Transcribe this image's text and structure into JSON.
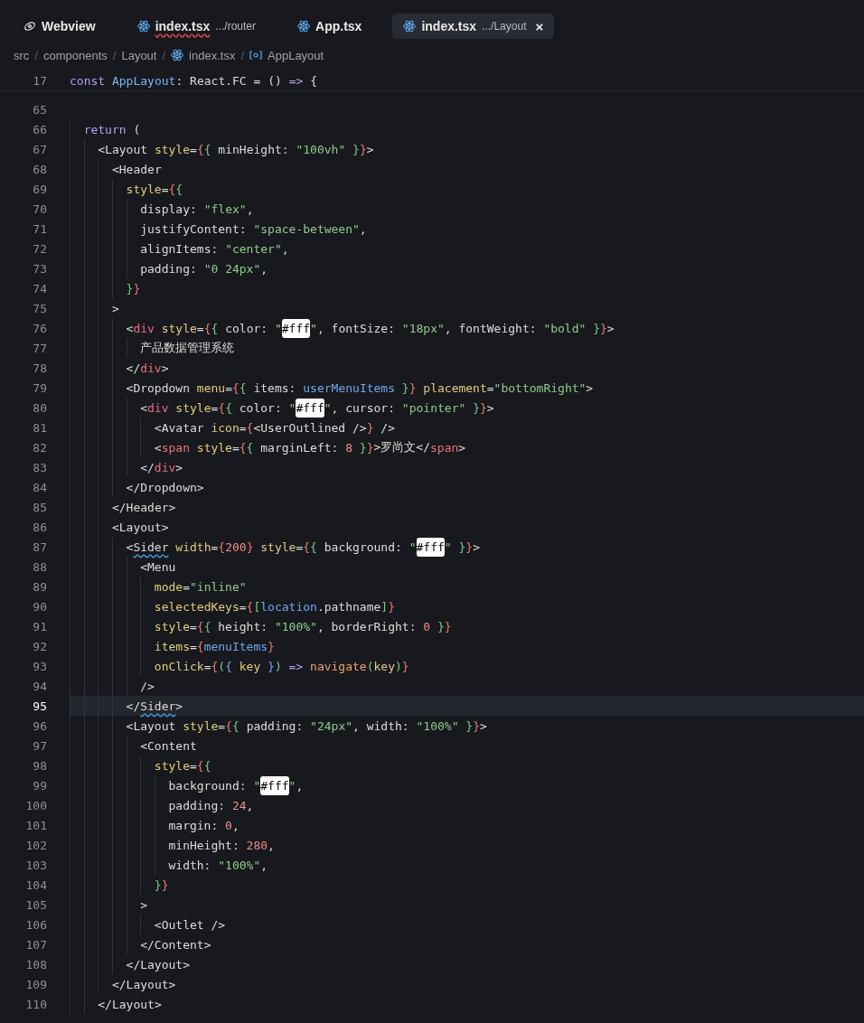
{
  "tabs": [
    {
      "kind": "eye",
      "label": "Webview",
      "selected": false,
      "error": false
    },
    {
      "kind": "react",
      "label": "index.tsx",
      "description": ".../router",
      "error": true,
      "selected": false
    },
    {
      "kind": "react",
      "label": "App.tsx",
      "selected": false,
      "error": false
    },
    {
      "kind": "react",
      "label": "index.tsx",
      "description": ".../Layout",
      "selected": true,
      "error": false,
      "close": "×"
    }
  ],
  "breadcrumb": {
    "separator": "/",
    "items": [
      {
        "label": "src"
      },
      {
        "label": "components"
      },
      {
        "label": "Layout"
      },
      {
        "label": "index.tsx",
        "kind": "react"
      },
      {
        "label": "AppLayout",
        "kind": "symbol"
      }
    ]
  },
  "sticky_line": {
    "number": "17",
    "tokens": [
      {
        "kind": "kw",
        "text": "const "
      },
      {
        "kind": "type",
        "text": "AppLayout"
      },
      {
        "kind": "text",
        "text": ": React.FC = () "
      },
      {
        "kind": "kw",
        "text": "=>"
      },
      {
        "kind": "text",
        "text": " {"
      }
    ]
  },
  "lines": [
    {
      "number": "65",
      "current": false
    },
    {
      "number": "66",
      "current": false,
      "tokens": [
        {
          "kind": "kw",
          "text": "  return"
        },
        {
          "kind": "text",
          "text": " ("
        }
      ]
    },
    {
      "number": "67",
      "current": false,
      "tokens": [
        {
          "kind": "text",
          "text": "    <Layout "
        },
        {
          "kind": "attr",
          "text": "style"
        },
        {
          "kind": "text",
          "text": "="
        },
        {
          "kind": "b1",
          "text": "{"
        },
        {
          "kind": "b2",
          "text": "{"
        },
        {
          "kind": "text",
          "text": " minHeight: "
        },
        {
          "kind": "str",
          "text": "\"100vh\" "
        },
        {
          "kind": "b2",
          "text": "}"
        },
        {
          "kind": "b1",
          "text": "}"
        },
        {
          "kind": "text",
          "text": ">"
        }
      ]
    },
    {
      "number": "68",
      "current": false,
      "tokens": [
        {
          "kind": "text",
          "text": "      <Header"
        }
      ]
    },
    {
      "number": "69",
      "current": false,
      "tokens": [
        {
          "kind": "attr",
          "text": "        style"
        },
        {
          "kind": "text",
          "text": "="
        },
        {
          "kind": "b1",
          "text": "{"
        },
        {
          "kind": "b2",
          "text": "{"
        }
      ]
    },
    {
      "number": "70",
      "current": false,
      "tokens": [
        {
          "kind": "text",
          "text": "          display: "
        },
        {
          "kind": "str",
          "text": "\"flex\""
        },
        {
          "kind": "text",
          "text": ","
        }
      ]
    },
    {
      "number": "71",
      "current": false,
      "tokens": [
        {
          "kind": "text",
          "text": "          justifyContent: "
        },
        {
          "kind": "str",
          "text": "\"space-between\""
        },
        {
          "kind": "text",
          "text": ","
        }
      ]
    },
    {
      "number": "72",
      "current": false,
      "tokens": [
        {
          "kind": "text",
          "text": "          alignItems: "
        },
        {
          "kind": "str",
          "text": "\"center\""
        },
        {
          "kind": "text",
          "text": ","
        }
      ]
    },
    {
      "number": "73",
      "current": false,
      "tokens": [
        {
          "kind": "text",
          "text": "          padding: "
        },
        {
          "kind": "str",
          "text": "\"0 24px\""
        },
        {
          "kind": "text",
          "text": ","
        }
      ]
    },
    {
      "number": "74",
      "current": false,
      "tokens": [
        {
          "kind": "b2",
          "text": "        }"
        },
        {
          "kind": "b1",
          "text": "}"
        }
      ]
    },
    {
      "number": "75",
      "current": false,
      "tokens": [
        {
          "kind": "text",
          "text": "      >"
        }
      ]
    },
    {
      "number": "76",
      "current": false,
      "tokens": [
        {
          "kind": "text",
          "text": "        <"
        },
        {
          "kind": "el",
          "text": "div"
        },
        {
          "kind": "attr",
          "text": " style"
        },
        {
          "kind": "text",
          "text": "="
        },
        {
          "kind": "b1",
          "text": "{"
        },
        {
          "kind": "b2",
          "text": "{"
        },
        {
          "kind": "text",
          "text": " color: "
        },
        {
          "kind": "str",
          "text": "\""
        },
        {
          "kind": "color",
          "text": "#fff"
        },
        {
          "kind": "str",
          "text": "\""
        },
        {
          "kind": "text",
          "text": ", fontSize: "
        },
        {
          "kind": "str",
          "text": "\"18px\""
        },
        {
          "kind": "text",
          "text": ", fontWeight: "
        },
        {
          "kind": "str",
          "text": "\"bold\" "
        },
        {
          "kind": "b2",
          "text": "}"
        },
        {
          "kind": "b1",
          "text": "}"
        },
        {
          "kind": "text",
          "text": ">"
        }
      ]
    },
    {
      "number": "77",
      "current": false,
      "tokens": [
        {
          "kind": "text",
          "text": "          产品数据管理系统"
        }
      ]
    },
    {
      "number": "78",
      "current": false,
      "tokens": [
        {
          "kind": "text",
          "text": "        </"
        },
        {
          "kind": "el",
          "text": "div"
        },
        {
          "kind": "text",
          "text": ">"
        }
      ]
    },
    {
      "number": "79",
      "current": false,
      "tokens": [
        {
          "kind": "text",
          "text": "        <Dropdown "
        },
        {
          "kind": "attr",
          "text": "menu"
        },
        {
          "kind": "text",
          "text": "="
        },
        {
          "kind": "b1",
          "text": "{"
        },
        {
          "kind": "b2",
          "text": "{"
        },
        {
          "kind": "text",
          "text": " items: "
        },
        {
          "kind": "var",
          "text": "userMenuItems "
        },
        {
          "kind": "b2",
          "text": "}"
        },
        {
          "kind": "b1",
          "text": "}"
        },
        {
          "kind": "attr",
          "text": " placement"
        },
        {
          "kind": "text",
          "text": "="
        },
        {
          "kind": "str",
          "text": "\"bottomRight\""
        },
        {
          "kind": "text",
          "text": ">"
        }
      ]
    },
    {
      "number": "80",
      "current": false,
      "tokens": [
        {
          "kind": "text",
          "text": "          <"
        },
        {
          "kind": "el",
          "text": "div"
        },
        {
          "kind": "attr",
          "text": " style"
        },
        {
          "kind": "text",
          "text": "="
        },
        {
          "kind": "b1",
          "text": "{"
        },
        {
          "kind": "b2",
          "text": "{"
        },
        {
          "kind": "text",
          "text": " color: "
        },
        {
          "kind": "str",
          "text": "\""
        },
        {
          "kind": "color",
          "text": "#fff"
        },
        {
          "kind": "str",
          "text": "\""
        },
        {
          "kind": "text",
          "text": ", cursor: "
        },
        {
          "kind": "str",
          "text": "\"pointer\" "
        },
        {
          "kind": "b2",
          "text": "}"
        },
        {
          "kind": "b1",
          "text": "}"
        },
        {
          "kind": "text",
          "text": ">"
        }
      ]
    },
    {
      "number": "81",
      "current": false,
      "tokens": [
        {
          "kind": "text",
          "text": "            <Avatar "
        },
        {
          "kind": "attr",
          "text": "icon"
        },
        {
          "kind": "text",
          "text": "="
        },
        {
          "kind": "b1",
          "text": "{"
        },
        {
          "kind": "text",
          "text": "<UserOutlined />"
        },
        {
          "kind": "b1",
          "text": "}"
        },
        {
          "kind": "text",
          "text": " />"
        }
      ]
    },
    {
      "number": "82",
      "current": false,
      "tokens": [
        {
          "kind": "text",
          "text": "            <"
        },
        {
          "kind": "el",
          "text": "span"
        },
        {
          "kind": "attr",
          "text": " style"
        },
        {
          "kind": "text",
          "text": "="
        },
        {
          "kind": "b1",
          "text": "{"
        },
        {
          "kind": "b2",
          "text": "{"
        },
        {
          "kind": "text",
          "text": " marginLeft: "
        },
        {
          "kind": "num",
          "text": "8 "
        },
        {
          "kind": "b2",
          "text": "}"
        },
        {
          "kind": "b1",
          "text": "}"
        },
        {
          "kind": "text",
          "text": ">罗尚文</"
        },
        {
          "kind": "el",
          "text": "span"
        },
        {
          "kind": "text",
          "text": ">"
        }
      ]
    },
    {
      "number": "83",
      "current": false,
      "tokens": [
        {
          "kind": "text",
          "text": "          </"
        },
        {
          "kind": "el",
          "text": "div"
        },
        {
          "kind": "text",
          "text": ">"
        }
      ]
    },
    {
      "number": "84",
      "current": false,
      "tokens": [
        {
          "kind": "text",
          "text": "        </Dropdown>"
        }
      ]
    },
    {
      "number": "85",
      "current": false,
      "tokens": [
        {
          "kind": "text",
          "text": "      </Header>"
        }
      ]
    },
    {
      "number": "86",
      "current": false,
      "tokens": [
        {
          "kind": "text",
          "text": "      <Layout>"
        }
      ]
    },
    {
      "number": "87",
      "current": false,
      "tokens": [
        {
          "kind": "text",
          "text": "        <"
        },
        {
          "kind": "text",
          "text": "Sider",
          "squiggle": true
        },
        {
          "kind": "attr",
          "text": " width"
        },
        {
          "kind": "text",
          "text": "="
        },
        {
          "kind": "b1",
          "text": "{"
        },
        {
          "kind": "num",
          "text": "200"
        },
        {
          "kind": "b1",
          "text": "}"
        },
        {
          "kind": "attr",
          "text": " style"
        },
        {
          "kind": "text",
          "text": "="
        },
        {
          "kind": "b1",
          "text": "{"
        },
        {
          "kind": "b2",
          "text": "{"
        },
        {
          "kind": "text",
          "text": " background: "
        },
        {
          "kind": "str",
          "text": "\""
        },
        {
          "kind": "color",
          "text": "#fff"
        },
        {
          "kind": "str",
          "text": "\" "
        },
        {
          "kind": "b2",
          "text": "}"
        },
        {
          "kind": "b1",
          "text": "}"
        },
        {
          "kind": "text",
          "text": ">"
        }
      ]
    },
    {
      "number": "88",
      "current": false,
      "tokens": [
        {
          "kind": "text",
          "text": "          <Menu"
        }
      ]
    },
    {
      "number": "89",
      "current": false,
      "tokens": [
        {
          "kind": "attr",
          "text": "            mode"
        },
        {
          "kind": "text",
          "text": "="
        },
        {
          "kind": "str",
          "text": "\"inline\""
        }
      ]
    },
    {
      "number": "90",
      "current": false,
      "tokens": [
        {
          "kind": "attr",
          "text": "            selectedKeys"
        },
        {
          "kind": "text",
          "text": "="
        },
        {
          "kind": "b1",
          "text": "{"
        },
        {
          "kind": "b2",
          "text": "["
        },
        {
          "kind": "var",
          "text": "location"
        },
        {
          "kind": "text",
          "text": ".pathname"
        },
        {
          "kind": "b2",
          "text": "]"
        },
        {
          "kind": "b1",
          "text": "}"
        }
      ]
    },
    {
      "number": "91",
      "current": false,
      "tokens": [
        {
          "kind": "attr",
          "text": "            style"
        },
        {
          "kind": "text",
          "text": "="
        },
        {
          "kind": "b1",
          "text": "{"
        },
        {
          "kind": "b2",
          "text": "{"
        },
        {
          "kind": "text",
          "text": " height: "
        },
        {
          "kind": "str",
          "text": "\"100%\""
        },
        {
          "kind": "text",
          "text": ", borderRight: "
        },
        {
          "kind": "num",
          "text": "0 "
        },
        {
          "kind": "b2",
          "text": "}"
        },
        {
          "kind": "b1",
          "text": "}"
        }
      ]
    },
    {
      "number": "92",
      "current": false,
      "tokens": [
        {
          "kind": "attr",
          "text": "            items"
        },
        {
          "kind": "text",
          "text": "="
        },
        {
          "kind": "b1",
          "text": "{"
        },
        {
          "kind": "var",
          "text": "menuItems"
        },
        {
          "kind": "b1",
          "text": "}"
        }
      ]
    },
    {
      "number": "93",
      "current": false,
      "tokens": [
        {
          "kind": "attr",
          "text": "            onClick"
        },
        {
          "kind": "text",
          "text": "="
        },
        {
          "kind": "b1",
          "text": "{"
        },
        {
          "kind": "b2",
          "text": "("
        },
        {
          "kind": "b3",
          "text": "{"
        },
        {
          "kind": "attr",
          "text": " key "
        },
        {
          "kind": "b3",
          "text": "}"
        },
        {
          "kind": "b2",
          "text": ")"
        },
        {
          "kind": "kw",
          "text": " => "
        },
        {
          "kind": "fn",
          "text": "navigate"
        },
        {
          "kind": "b2",
          "text": "("
        },
        {
          "kind": "attr",
          "text": "key"
        },
        {
          "kind": "b2",
          "text": ")"
        },
        {
          "kind": "b1",
          "text": "}"
        }
      ]
    },
    {
      "number": "94",
      "current": false,
      "tokens": [
        {
          "kind": "text",
          "text": "          />"
        }
      ]
    },
    {
      "number": "95",
      "current": true,
      "tokens": [
        {
          "kind": "text",
          "text": "        </"
        },
        {
          "kind": "text",
          "text": "Sider",
          "squiggle": true
        },
        {
          "kind": "text",
          "text": ">"
        }
      ]
    },
    {
      "number": "96",
      "current": false,
      "tokens": [
        {
          "kind": "text",
          "text": "        <Layout "
        },
        {
          "kind": "attr",
          "text": "style"
        },
        {
          "kind": "text",
          "text": "="
        },
        {
          "kind": "b1",
          "text": "{"
        },
        {
          "kind": "b2",
          "text": "{"
        },
        {
          "kind": "text",
          "text": " padding: "
        },
        {
          "kind": "str",
          "text": "\"24px\""
        },
        {
          "kind": "text",
          "text": ", width: "
        },
        {
          "kind": "str",
          "text": "\"100%\" "
        },
        {
          "kind": "b2",
          "text": "}"
        },
        {
          "kind": "b1",
          "text": "}"
        },
        {
          "kind": "text",
          "text": ">"
        }
      ]
    },
    {
      "number": "97",
      "current": false,
      "tokens": [
        {
          "kind": "text",
          "text": "          <Content"
        }
      ]
    },
    {
      "number": "98",
      "current": false,
      "tokens": [
        {
          "kind": "attr",
          "text": "            style"
        },
        {
          "kind": "text",
          "text": "="
        },
        {
          "kind": "b1",
          "text": "{"
        },
        {
          "kind": "b2",
          "text": "{"
        }
      ]
    },
    {
      "number": "99",
      "current": false,
      "tokens": [
        {
          "kind": "text",
          "text": "              background: "
        },
        {
          "kind": "str",
          "text": "\""
        },
        {
          "kind": "color",
          "text": "#fff"
        },
        {
          "kind": "str",
          "text": "\""
        },
        {
          "kind": "text",
          "text": ","
        }
      ]
    },
    {
      "number": "100",
      "current": false,
      "tokens": [
        {
          "kind": "text",
          "text": "              padding: "
        },
        {
          "kind": "num",
          "text": "24"
        },
        {
          "kind": "text",
          "text": ","
        }
      ]
    },
    {
      "number": "101",
      "current": false,
      "tokens": [
        {
          "kind": "text",
          "text": "              margin: "
        },
        {
          "kind": "num",
          "text": "0"
        },
        {
          "kind": "text",
          "text": ","
        }
      ]
    },
    {
      "number": "102",
      "current": false,
      "tokens": [
        {
          "kind": "text",
          "text": "              minHeight: "
        },
        {
          "kind": "num",
          "text": "280"
        },
        {
          "kind": "text",
          "text": ","
        }
      ]
    },
    {
      "number": "103",
      "current": false,
      "tokens": [
        {
          "kind": "text",
          "text": "              width: "
        },
        {
          "kind": "str",
          "text": "\"100%\""
        },
        {
          "kind": "text",
          "text": ","
        }
      ]
    },
    {
      "number": "104",
      "current": false,
      "tokens": [
        {
          "kind": "b2",
          "text": "            }"
        },
        {
          "kind": "b1",
          "text": "}"
        }
      ]
    },
    {
      "number": "105",
      "current": false,
      "tokens": [
        {
          "kind": "text",
          "text": "          >"
        }
      ]
    },
    {
      "number": "106",
      "current": false,
      "tokens": [
        {
          "kind": "text",
          "text": "            <Outlet />"
        }
      ]
    },
    {
      "number": "107",
      "current": false,
      "tokens": [
        {
          "kind": "text",
          "text": "          </Content>"
        }
      ]
    },
    {
      "number": "108",
      "current": false,
      "tokens": [
        {
          "kind": "text",
          "text": "        </Layout>"
        }
      ]
    },
    {
      "number": "109",
      "current": false,
      "tokens": [
        {
          "kind": "text",
          "text": "      </Layout>"
        }
      ]
    },
    {
      "number": "110",
      "current": false,
      "tokens": [
        {
          "kind": "text",
          "text": "    </Layout>"
        }
      ]
    }
  ]
}
